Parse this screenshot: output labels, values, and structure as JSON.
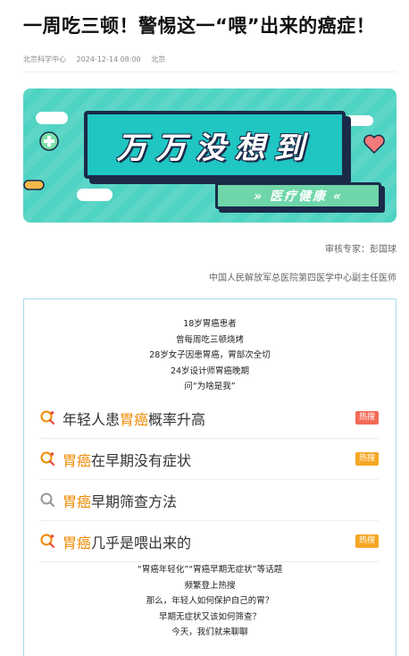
{
  "article": {
    "title": "一周吃三顿！警惕这一“喂”出来的癌症！",
    "source": "北京科学中心",
    "datetime": "2024-12-14 08:00",
    "location": "北京"
  },
  "banner": {
    "main_text": "万万没想到",
    "sub_text": "» 医疗健康 «"
  },
  "credits": {
    "reviewer": "审核专家：彭国球",
    "reviewer_title": "中国人民解放军总医院第四医学中心副主任医师"
  },
  "intro_lines": [
    "18岁胃癌患者",
    "曾每周吃三顿烧烤",
    "28岁女子因患胃癌，胃部次全切",
    "24岁设计师胃癌晚期",
    "问“为啥是我”"
  ],
  "searches": [
    {
      "pre": "年轻人患",
      "hl": "胃癌",
      "post": "概率升高",
      "badge": "热搜",
      "badge_color": "#f46a55",
      "icon": "search-hot-icon"
    },
    {
      "pre": "",
      "hl": "胃癌",
      "post": "在早期没有症状",
      "badge": "热搜",
      "badge_color": "#f5a623",
      "icon": "search-hot-icon"
    },
    {
      "pre": "",
      "hl": "胃癌",
      "post": "早期筛查方法",
      "badge": "",
      "badge_color": "",
      "icon": "search-icon"
    },
    {
      "pre": "",
      "hl": "胃癌",
      "post": "几乎是喂出来的",
      "badge": "热搜",
      "badge_color": "#f5a623",
      "icon": "search-hot-icon"
    }
  ],
  "outro_lines": [
    "“胃癌年轻化”“胃癌早期无症状”等话题",
    "频繁登上热搜",
    "那么，年轻人如何保护自己的胃？",
    "早期无症状又该如何筛查？",
    "今天，我们就来聊聊"
  ]
}
